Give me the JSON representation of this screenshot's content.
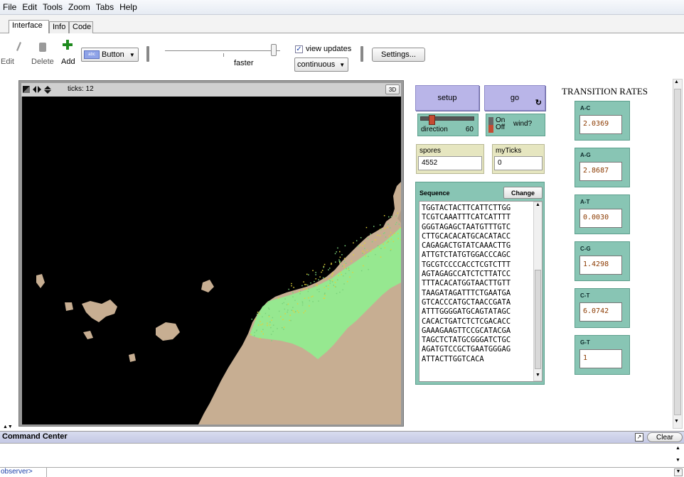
{
  "menu": [
    "File",
    "Edit",
    "Tools",
    "Zoom",
    "Tabs",
    "Help"
  ],
  "tabs": [
    "Interface",
    "Info",
    "Code"
  ],
  "active_tab": "Interface",
  "toolbar": {
    "edit": "Edit",
    "delete": "Delete",
    "add": "Add",
    "widget_type": "Button",
    "speed_label": "faster",
    "view_updates_label": "view updates",
    "view_updates_checked": true,
    "update_mode": "continuous",
    "settings": "Settings..."
  },
  "view": {
    "ticks_label": "ticks: 12",
    "three_d": "3D"
  },
  "widgets": {
    "setup": "setup",
    "go": "go",
    "direction_label": "direction",
    "direction_value": "60",
    "direction_fraction": 0.17,
    "wind_on": "On",
    "wind_off": "Off",
    "wind_label": "wind?",
    "spores_label": "spores",
    "spores_value": "4552",
    "myticks_label": "myTicks",
    "myticks_value": "0",
    "sequence_label": "Sequence",
    "change_button": "Change",
    "sequence_lines": [
      "TGGTACTACTTCATTCTTGG",
      "TCGTCAAATTTCATCATTTT",
      "GGGTAGAGCTAATGTTTGTC",
      "CTTGCACACATGCACATACC",
      "CAGAGACTGTATCAAACTTG",
      "ATTGTCTATGTGGACCCAGC",
      "TGCGTCCCCACCTCGTCTTT",
      "AGTAGAGCCATCTCTTATCC",
      "TTTACACATGGTAACTTGTT",
      "TAAGATAGATTTCTGAATGA",
      "GTCACCCATGCTAACCGATA",
      "ATTTGGGGATGCAGTATAGC",
      "CACACTGATCTCTCGACACC",
      "GAAAGAAGTTCCGCATACGA",
      "TAGCTCTATGCGGGATCTGC",
      "AGATGTCCGCTGAATGGGAG",
      "ATTACTTGGTCACA"
    ]
  },
  "transition_rates": {
    "title": "TRANSITION RATES",
    "items": [
      {
        "label": "A-C",
        "value": "2.0369"
      },
      {
        "label": "A-G",
        "value": "2.8687"
      },
      {
        "label": "A-T",
        "value": "0.0030"
      },
      {
        "label": "C-G",
        "value": "1.4298"
      },
      {
        "label": "C-T",
        "value": "6.0742"
      },
      {
        "label": "G-T",
        "value": "1"
      }
    ]
  },
  "command_center": {
    "title": "Command Center",
    "clear": "Clear",
    "prompt": "observer>"
  },
  "colors": {
    "button_purple": "#b9b5e8",
    "slider_green": "#88c5b4",
    "monitor_yellow": "#e6e6c0",
    "world_bg": "#000000",
    "land": "#c7ae92",
    "spores": "#90ee90",
    "rate_value": "#8b3a00"
  }
}
